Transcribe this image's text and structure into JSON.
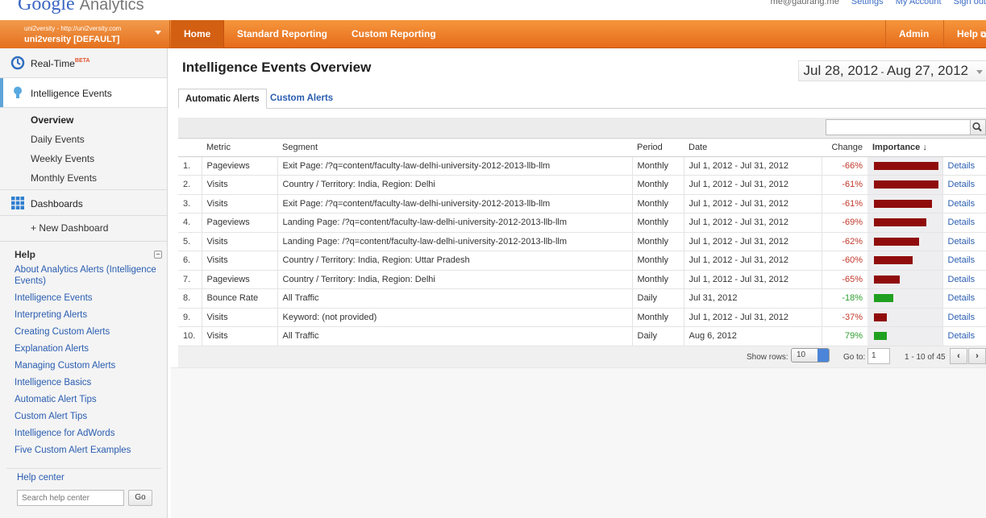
{
  "header": {
    "logo_text": "Google",
    "product": "Analytics",
    "user_email": "me@gaurang.me",
    "links": [
      "Settings",
      "My Account",
      "Sign out"
    ]
  },
  "account": {
    "line1": "uni2versity - http://uni2versity.com",
    "line2": "uni2versity [DEFAULT]"
  },
  "nav": {
    "home": "Home",
    "standard": "Standard Reporting",
    "custom": "Custom Reporting",
    "admin": "Admin",
    "help": "Help"
  },
  "sidebar": {
    "realtime": "Real-Time",
    "beta": "BETA",
    "intelligence": "Intelligence Events",
    "sub": [
      "Overview",
      "Daily Events",
      "Weekly Events",
      "Monthly Events"
    ],
    "dashboards": "Dashboards",
    "new_dashboard": "+ New Dashboard",
    "help_title": "Help",
    "help_links": [
      "About Analytics Alerts (Intelligence Events)",
      "Intelligence Events",
      "Interpreting Alerts",
      "Creating Custom Alerts",
      "Explanation Alerts",
      "Managing Custom Alerts",
      "Intelligence Basics",
      "Automatic Alert Tips",
      "Custom Alert Tips",
      "Intelligence for AdWords",
      "Five Custom Alert Examples"
    ],
    "help_center": "Help center",
    "search_placeholder": "Search help center",
    "go": "Go"
  },
  "main": {
    "title": "Intelligence Events Overview",
    "date_start": "Jul 28, 2012",
    "date_sep": " - ",
    "date_end": "Aug 27, 2012",
    "tabs": [
      "Automatic Alerts",
      "Custom Alerts"
    ],
    "columns": [
      "Metric",
      "Segment",
      "Period",
      "Date",
      "Change",
      "Importance"
    ],
    "importance_arrow": "↓",
    "rows": [
      {
        "n": "1.",
        "metric": "Pageviews",
        "segment": "Exit Page: /?q=content/faculty-law-delhi-university-2012-2013-llb-llm",
        "period": "Monthly",
        "date": "Jul 1, 2012 - Jul 31, 2012",
        "change": "-66%",
        "importance": 1.0,
        "color": "red",
        "details": "Details"
      },
      {
        "n": "2.",
        "metric": "Visits",
        "segment": "Country / Territory: India, Region: Delhi",
        "period": "Monthly",
        "date": "Jul 1, 2012 - Jul 31, 2012",
        "change": "-61%",
        "importance": 1.0,
        "color": "red",
        "details": "Details"
      },
      {
        "n": "3.",
        "metric": "Visits",
        "segment": "Exit Page: /?q=content/faculty-law-delhi-university-2012-2013-llb-llm",
        "period": "Monthly",
        "date": "Jul 1, 2012 - Jul 31, 2012",
        "change": "-61%",
        "importance": 0.9,
        "color": "red",
        "details": "Details"
      },
      {
        "n": "4.",
        "metric": "Pageviews",
        "segment": "Landing Page: /?q=content/faculty-law-delhi-university-2012-2013-llb-llm",
        "period": "Monthly",
        "date": "Jul 1, 2012 - Jul 31, 2012",
        "change": "-69%",
        "importance": 0.81,
        "color": "red",
        "details": "Details"
      },
      {
        "n": "5.",
        "metric": "Visits",
        "segment": "Landing Page: /?q=content/faculty-law-delhi-university-2012-2013-llb-llm",
        "period": "Monthly",
        "date": "Jul 1, 2012 - Jul 31, 2012",
        "change": "-62%",
        "importance": 0.7,
        "color": "red",
        "details": "Details"
      },
      {
        "n": "6.",
        "metric": "Visits",
        "segment": "Country / Territory: India, Region: Uttar Pradesh",
        "period": "Monthly",
        "date": "Jul 1, 2012 - Jul 31, 2012",
        "change": "-60%",
        "importance": 0.6,
        "color": "red",
        "details": "Details"
      },
      {
        "n": "7.",
        "metric": "Pageviews",
        "segment": "Country / Territory: India, Region: Delhi",
        "period": "Monthly",
        "date": "Jul 1, 2012 - Jul 31, 2012",
        "change": "-65%",
        "importance": 0.4,
        "color": "red",
        "details": "Details"
      },
      {
        "n": "8.",
        "metric": "Bounce Rate",
        "segment": "All Traffic",
        "period": "Daily",
        "date": "Jul 31, 2012",
        "change": "-18%",
        "importance": 0.3,
        "color": "green",
        "details": "Details"
      },
      {
        "n": "9.",
        "metric": "Visits",
        "segment": "Keyword: (not provided)",
        "period": "Monthly",
        "date": "Jul 1, 2012 - Jul 31, 2012",
        "change": "-37%",
        "importance": 0.2,
        "color": "red",
        "details": "Details"
      },
      {
        "n": "10.",
        "metric": "Visits",
        "segment": "All Traffic",
        "period": "Daily",
        "date": "Aug 6, 2012",
        "change": "79%",
        "importance": 0.2,
        "color": "green",
        "details": "Details"
      }
    ],
    "pager": {
      "show_rows_label": "Show rows:",
      "rows_value": "10",
      "goto_label": "Go to:",
      "goto_value": "1",
      "range": "1 - 10 of 45",
      "prev": "‹",
      "next": "›"
    }
  },
  "colors": {
    "nav_orange": "#e66b1b",
    "bar_red": "#900c0c",
    "bar_green": "#20a020",
    "link_blue": "#2a5db0"
  }
}
